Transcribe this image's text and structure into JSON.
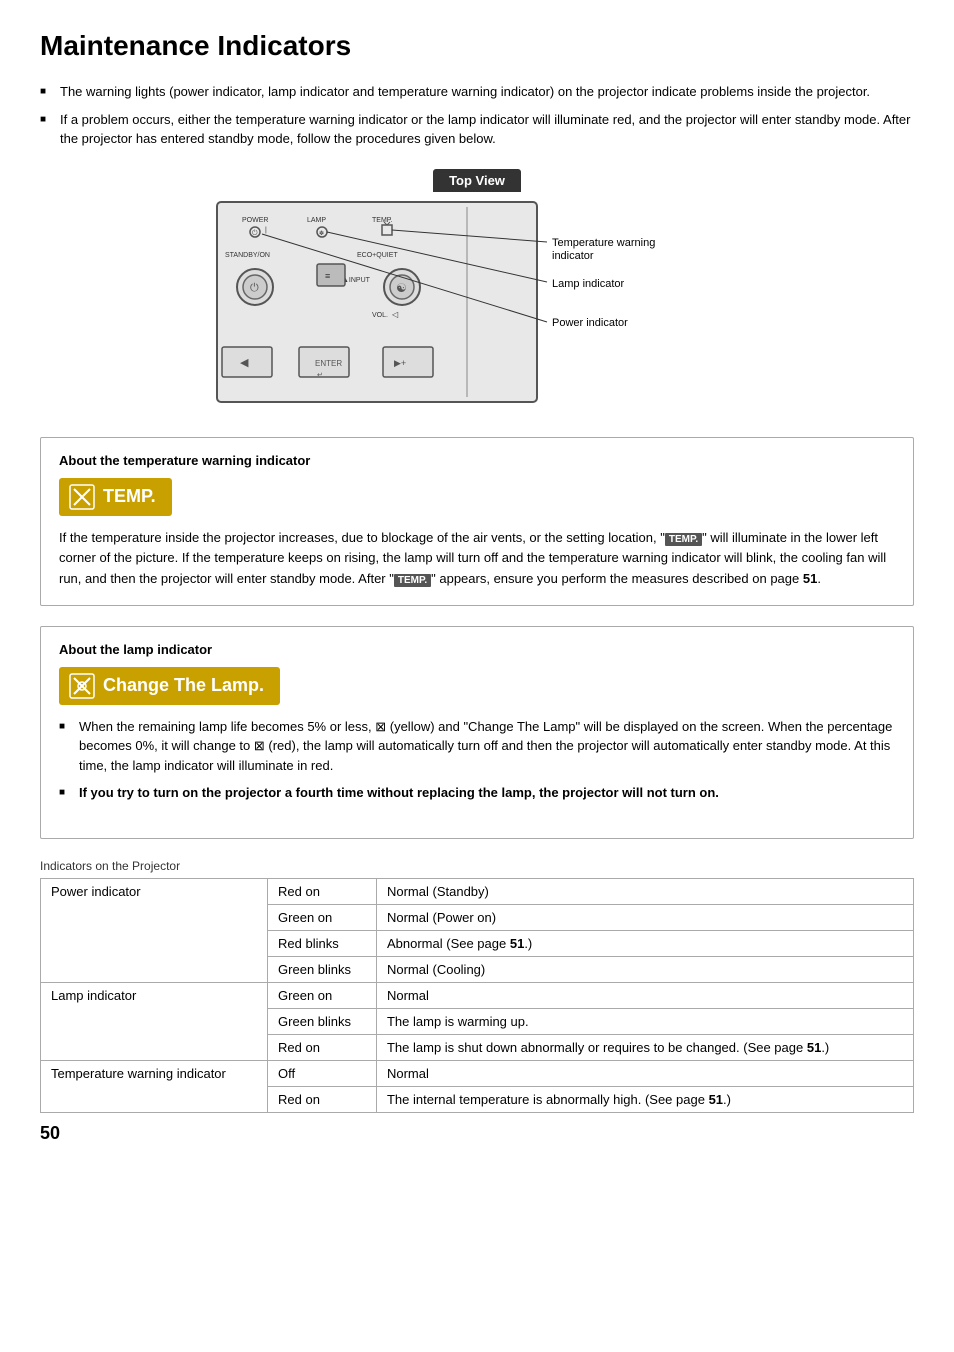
{
  "page": {
    "title": "Maintenance Indicators",
    "page_number": "50"
  },
  "intro_bullets": [
    "The warning lights (power indicator, lamp indicator and temperature warning indicator) on the projector indicate problems inside the projector.",
    "If a problem occurs, either the temperature warning indicator or the lamp indicator will illuminate red, and the projector will enter standby mode. After the projector has entered standby mode, follow the procedures given below."
  ],
  "diagram": {
    "label": "Top View",
    "callouts": [
      "Temperature warning indicator",
      "Lamp indicator",
      "Power indicator"
    ]
  },
  "temp_section": {
    "title": "About the temperature warning indicator",
    "display_text": "TEMP.",
    "body": "If the temperature inside the projector increases, due to blockage of the air vents, or the setting location, “TEMP.” will illuminate in the lower left corner of the picture. If the temperature keeps on rising, the lamp will turn off and the temperature warning indicator will blink, the cooling fan will run, and then the projector will enter standby mode. After “TEMP.” appears, ensure you perform the measures described on page 51."
  },
  "lamp_section": {
    "title": "About the lamp indicator",
    "display_text": "Change The Lamp.",
    "bullets": [
      "When the remaining lamp life becomes 5% or less, ☒ (yellow) and “Change The Lamp” will be displayed on the screen. When the percentage becomes 0%, it will change to ☒ (red), the lamp will automatically turn off and then the projector will automatically enter standby mode. At this time, the lamp indicator will illuminate in red.",
      "If you try to turn on the projector a fourth time without replacing the lamp, the projector will not turn on."
    ]
  },
  "table": {
    "title": "Indicators on the Projector",
    "rows": [
      {
        "indicator": "Power indicator",
        "rowspan": 4,
        "status": "Red on",
        "description": "Normal (Standby)"
      },
      {
        "indicator": "",
        "status": "Green on",
        "description": "Normal (Power on)"
      },
      {
        "indicator": "",
        "status": "Red blinks",
        "description": "Abnormal (See page 51.)"
      },
      {
        "indicator": "",
        "status": "Green blinks",
        "description": "Normal (Cooling)"
      },
      {
        "indicator": "Lamp indicator",
        "rowspan": 3,
        "status": "Green on",
        "description": "Normal"
      },
      {
        "indicator": "",
        "status": "Green blinks",
        "description": "The lamp is warming up."
      },
      {
        "indicator": "",
        "status": "Red on",
        "description": "The lamp is shut down abnormally or requires to be changed. (See page 51.)"
      },
      {
        "indicator": "Temperature warning indicator",
        "rowspan": 2,
        "status": "Off",
        "description": "Normal"
      },
      {
        "indicator": "",
        "status": "Red on",
        "description": "The internal temperature is abnormally high. (See page 51.)"
      }
    ]
  }
}
